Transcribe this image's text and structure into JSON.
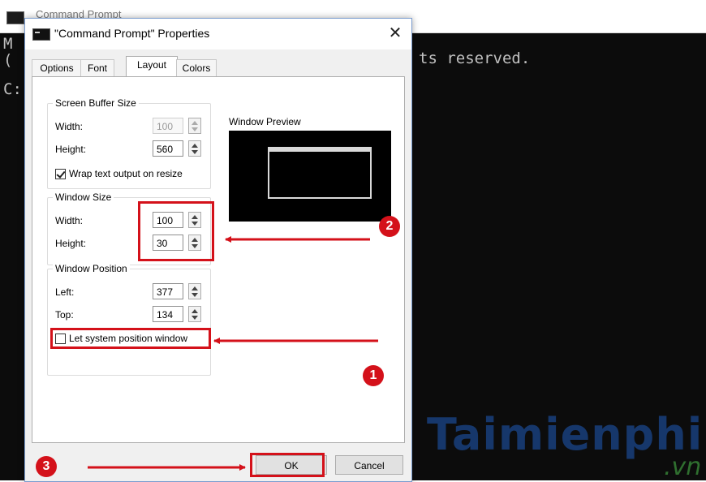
{
  "background_window": {
    "title": "Command Prompt",
    "console_lines": [
      "M",
      "(",
      "C:"
    ],
    "console_tail": "ts reserved."
  },
  "watermark": {
    "main": "Taimienphi",
    "sub": ".vn"
  },
  "dialog": {
    "title": "\"Command Prompt\" Properties",
    "close_glyph": "✕",
    "tabs": [
      "Options",
      "Font",
      "Layout",
      "Colors"
    ],
    "active_tab": "Layout",
    "screen_buffer": {
      "label": "Screen Buffer Size",
      "width_label": "Width:",
      "width_value": "100",
      "height_label": "Height:",
      "height_value": "560",
      "wrap_label": "Wrap text output on resize",
      "wrap_checked": true
    },
    "window_size": {
      "label": "Window Size",
      "width_label": "Width:",
      "width_value": "100",
      "height_label": "Height:",
      "height_value": "30"
    },
    "window_position": {
      "label": "Window Position",
      "left_label": "Left:",
      "left_value": "377",
      "top_label": "Top:",
      "top_value": "134",
      "system_label": "Let system position window",
      "system_checked": false
    },
    "preview_label": "Window Preview",
    "ok_label": "OK",
    "cancel_label": "Cancel"
  },
  "annotations": {
    "step1": "1",
    "step2": "2",
    "step3": "3",
    "color": "#d4111a"
  }
}
